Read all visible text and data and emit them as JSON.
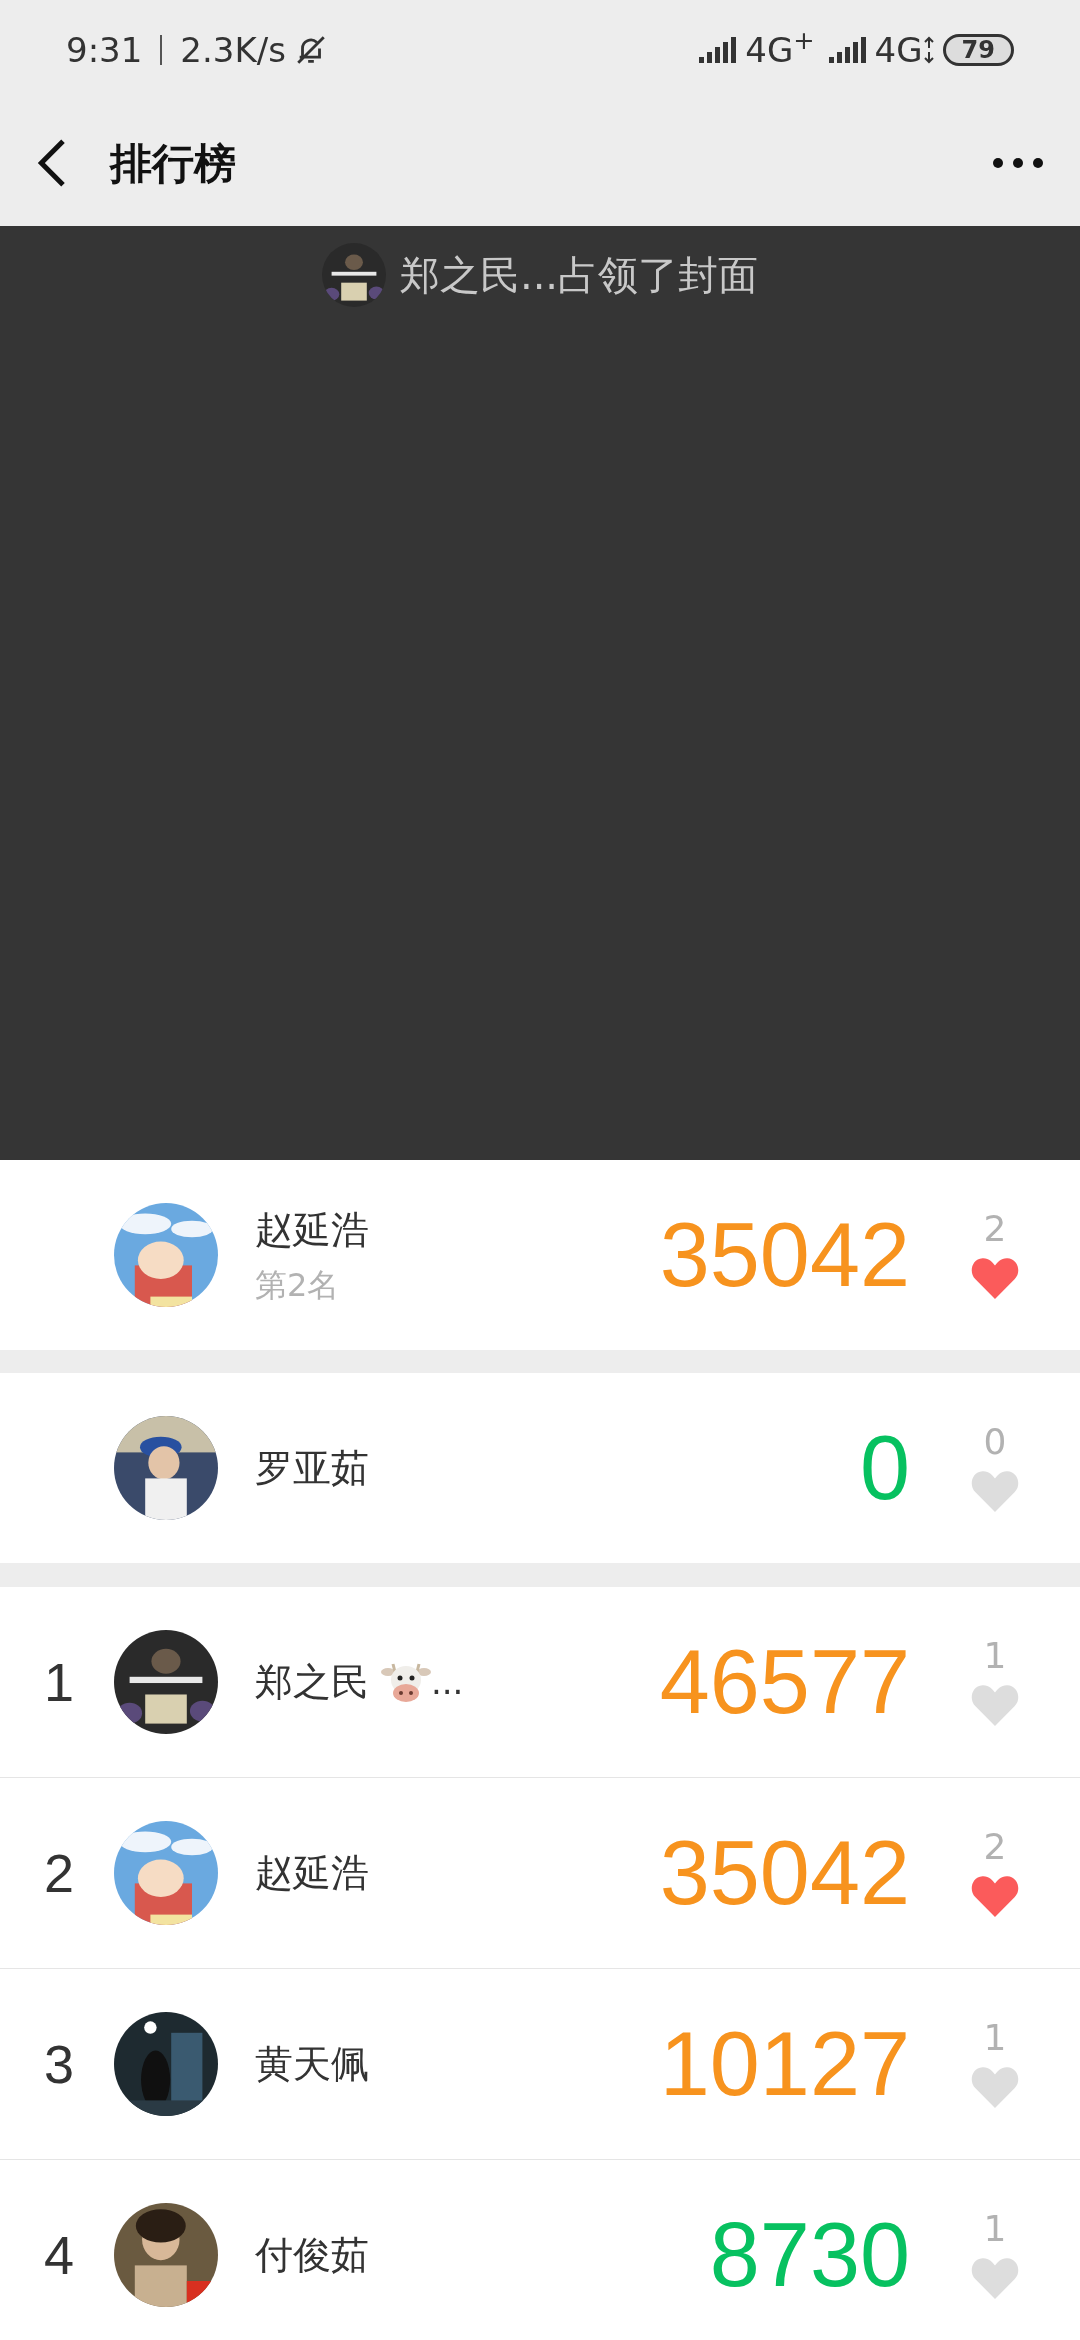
{
  "status_bar": {
    "time": "9:31",
    "speed": "2.3K/s",
    "network_1": "4G$^{+}$",
    "network_2": "4G",
    "battery": "79"
  },
  "header": {
    "title": "排行榜"
  },
  "cover": {
    "caption": "郑之民...占领了封面"
  },
  "my_entry": {
    "name": "赵延浩",
    "subtitle": "第2名",
    "steps": "35042",
    "color": "#f7931e",
    "likes": "2",
    "liked": true
  },
  "friend_entry": {
    "name": "罗亚茹",
    "steps": "0",
    "color": "#07c160",
    "likes": "0",
    "liked": false
  },
  "ranking": [
    {
      "rank": "1",
      "name": "郑之民",
      "name_suffix": "...",
      "emoji": true,
      "steps": "46577",
      "color": "#f7931e",
      "likes": "1",
      "liked": false
    },
    {
      "rank": "2",
      "name": "赵延浩",
      "emoji": false,
      "steps": "35042",
      "color": "#f7931e",
      "likes": "2",
      "liked": true
    },
    {
      "rank": "3",
      "name": "黄天佩",
      "emoji": false,
      "steps": "10127",
      "color": "#f7931e",
      "likes": "1",
      "liked": false
    },
    {
      "rank": "4",
      "name": "付俊茹",
      "emoji": false,
      "steps": "8730",
      "color": "#07c160",
      "likes": "1",
      "liked": false
    }
  ]
}
